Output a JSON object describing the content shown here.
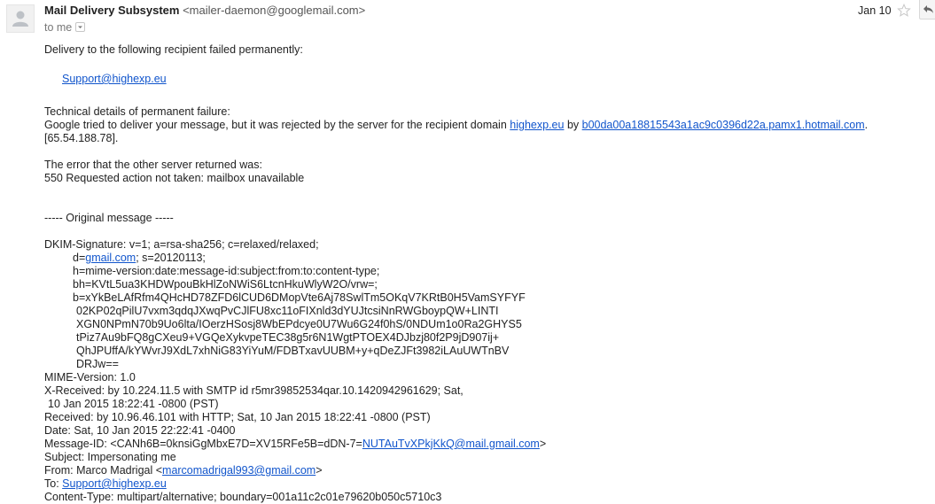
{
  "message": {
    "sender_name": "Mail Delivery Subsystem",
    "sender_email": "<mailer-daemon@googlemail.com>",
    "to_label": "to me",
    "date": "Jan 10"
  },
  "body": {
    "intro": "Delivery to the following recipient failed permanently:",
    "recipient": "Support@highexp.eu",
    "tech_heading": "Technical details of permanent failure:",
    "tech_line_pre": "Google tried to deliver your message, but it was rejected by the server for the recipient domain",
    "tech_domain": "highexp.eu",
    "tech_by": "by",
    "tech_host": "b00da00a18815543a1ac9c0396d22a.pamx1.hotmail.com",
    "tech_dot": ".",
    "tech_ip": "[65.54.188.78].",
    "error_heading": "The error that the other server returned was:",
    "error_text": "550 Requested action not taken: mailbox unavailable",
    "original_marker": "----- Original message -----",
    "dkim_1": "DKIM-Signature: v=1; a=rsa-sha256; c=relaxed/relaxed;",
    "dkim_2_pre": "d=",
    "dkim_2_link": "gmail.com",
    "dkim_2_post": "; s=20120113;",
    "dkim_3": "h=mime-version:date:message-id:subject:from:to:content-type;",
    "dkim_4": "bh=KVtL5ua3KHDWpouBkHlZoNWiS6LtcnHkuWlyW2O/vrw=;",
    "dkim_5": "b=xYkBeLAfRfm4QHcHD78ZFD6lCUD6DMopVte6Aj78SwlTm5OKqV7KRtB0H5VamSYFYF",
    "dkim_6": "02KP02qPilU7vxm3qdqJXwqPvCJlFU8xc11oFIXnld3dYUJtcsiNnRWGboypQW+LINTI",
    "dkim_7": "XGN0NPmN70b9Uo6lta/IOerzHSosj8WbEPdcye0U7Wu6G24f0hS/0NDUm1o0Ra2GHYS5",
    "dkim_8": "tPiz7Au9bFQ8gCXeu9+VGQeXykvpeTEC38g5r6N1WgtPTOEX4DJbzj80f2P9jD907ij+",
    "dkim_9": "QhJPUffA/kYWvrJ9XdL7xhNiG83YiYuM/FDBTxavUUBM+y+qDeZJFt3982iLAuUWTnBV",
    "dkim_10": "DRJw==",
    "mime_version": "MIME-Version: 1.0",
    "x_received_1": "X-Received: by 10.224.11.5 with SMTP id r5mr39852534qar.10.1420942961629; Sat,",
    "x_received_2": "10 Jan 2015 18:22:41 -0800 (PST)",
    "received": "Received: by 10.96.46.101 with HTTP; Sat, 10 Jan 2015 18:22:41 -0800 (PST)",
    "date_header": "Date: Sat, 10 Jan 2015 22:22:41 -0400",
    "message_id_pre": "Message-ID: <CANh6B=0knsiGgMbxE7D=XV15RFe5B=dDN-7=",
    "message_id_link": "NUTAuTvXPkjKkQ@mail.gmail.com",
    "message_id_post": ">",
    "subject": "Subject: Impersonating me",
    "from_pre": "From: Marco Madrigal <",
    "from_link": "marcomadrigal993@gmail.com",
    "from_post": ">",
    "to_pre": "To: ",
    "to_link": "Support@highexp.eu",
    "content_type": "Content-Type: multipart/alternative; boundary=001a11c2c01e79620b050c5710c3"
  },
  "colors": {
    "link": "#1155cc",
    "text": "#222222",
    "muted": "#777777"
  },
  "icons": {
    "avatar": "person-silhouette-icon",
    "dropdown": "chevron-down-icon",
    "star": "star-outline-icon",
    "reply": "reply-arrow-icon"
  }
}
